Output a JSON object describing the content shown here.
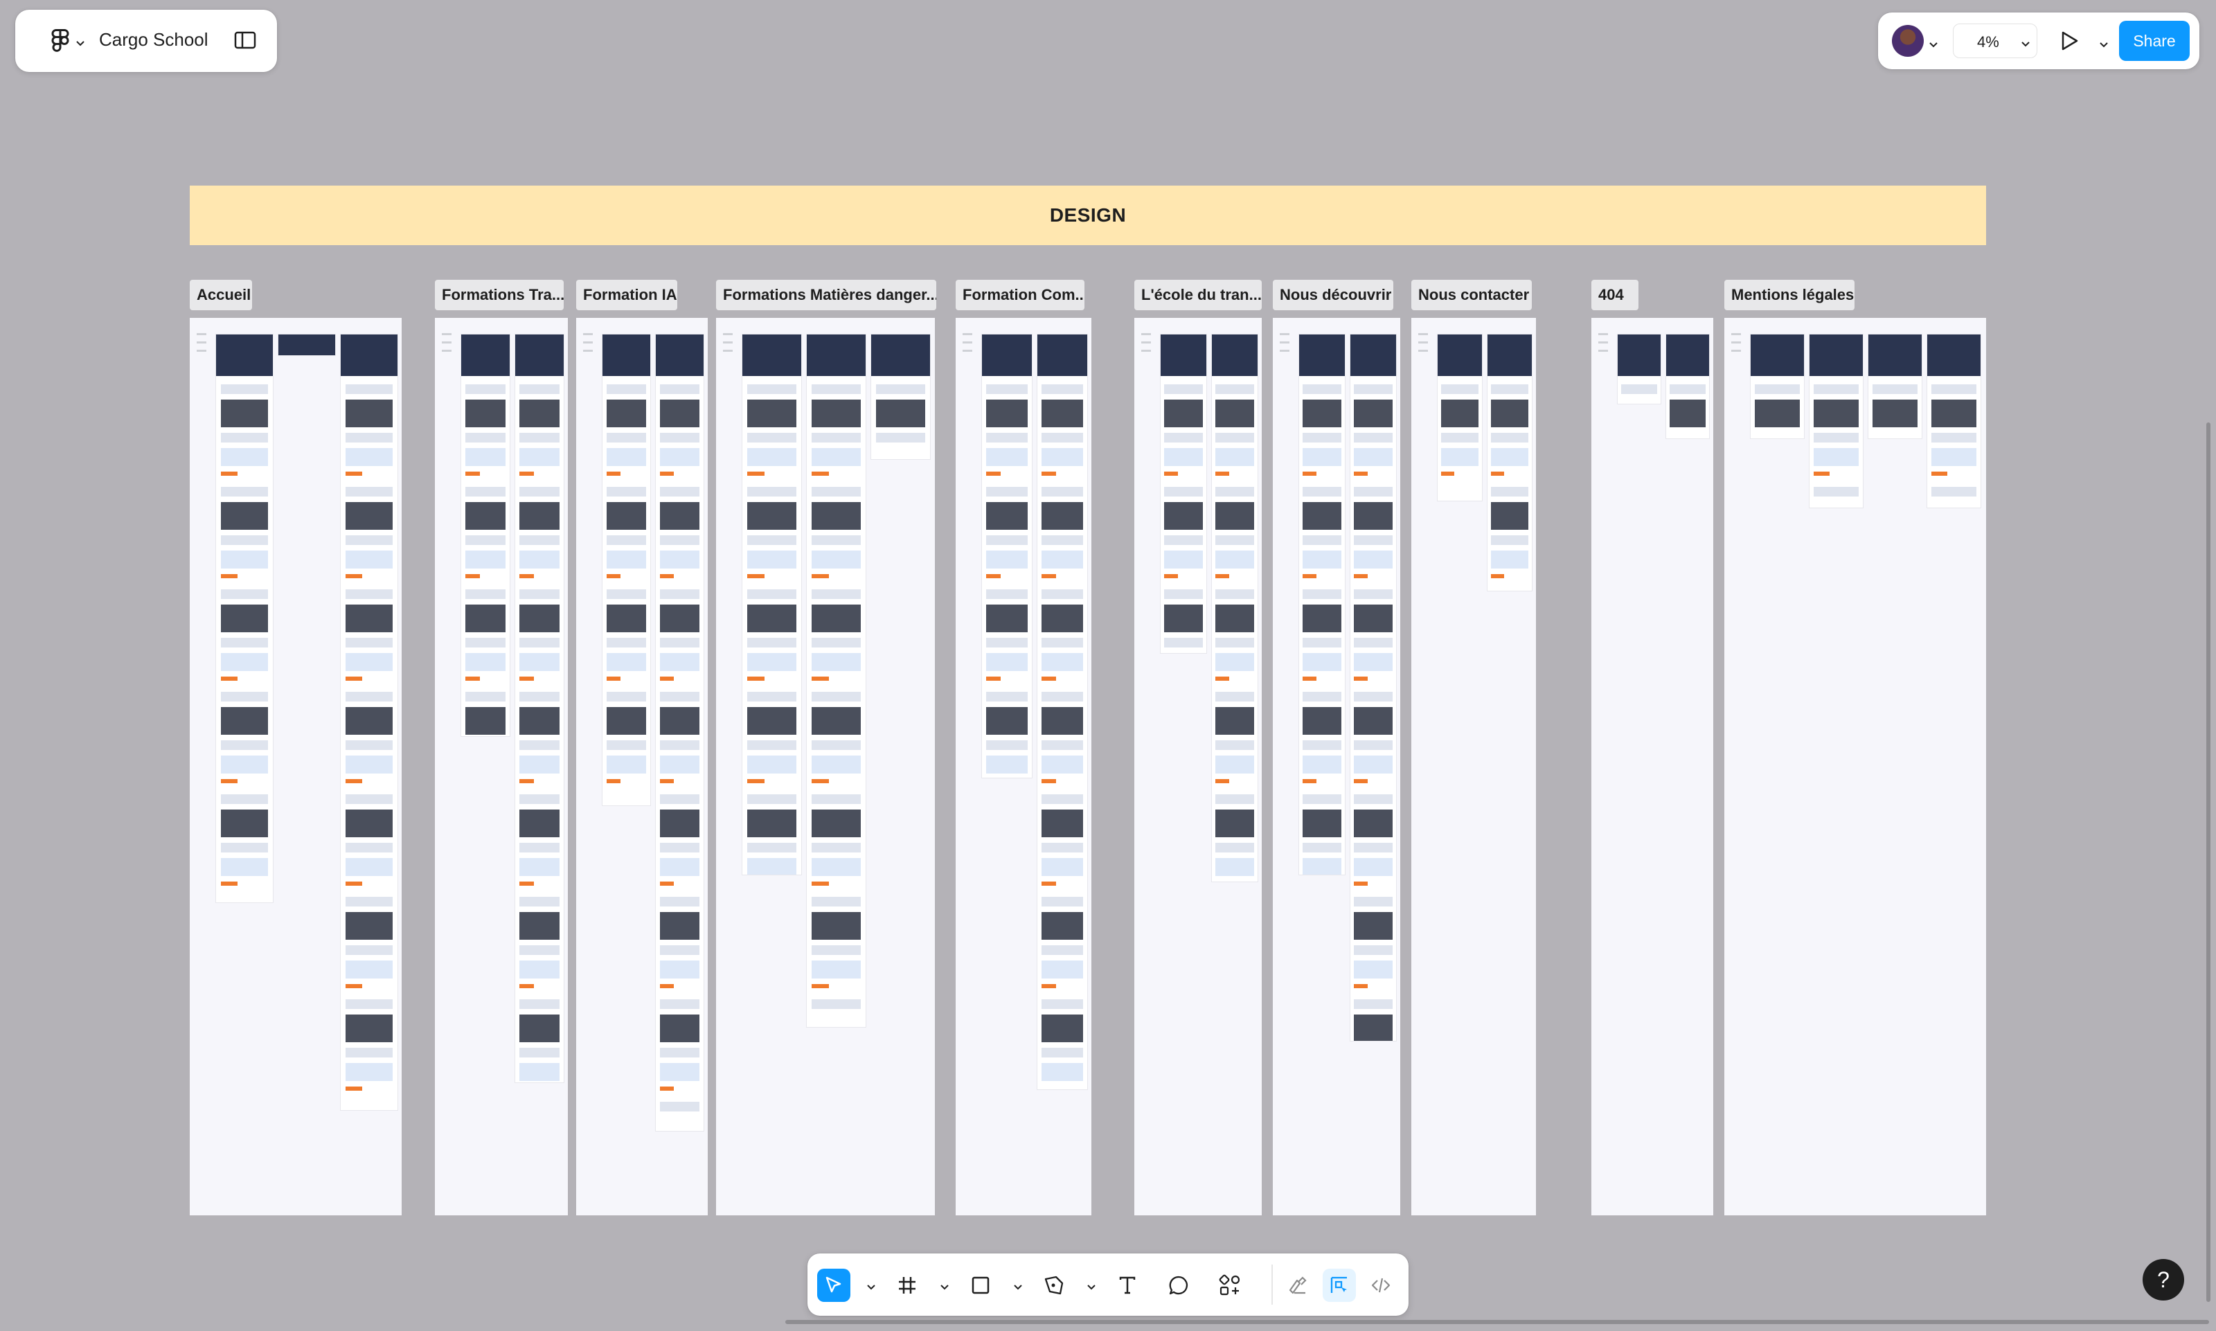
{
  "file": {
    "title": "Cargo School"
  },
  "topbar": {
    "zoom": "4%",
    "share_label": "Share"
  },
  "canvas": {
    "banner": "DESIGN",
    "sections": [
      {
        "label": "Accueil",
        "pages": 3
      },
      {
        "label": "Formations Tra...",
        "pages": 2
      },
      {
        "label": "Formation IA",
        "pages": 2
      },
      {
        "label": "Formations Matières danger...",
        "pages": 3
      },
      {
        "label": "Formation Com...",
        "pages": 2
      },
      {
        "label": "L'école du tran...",
        "pages": 2
      },
      {
        "label": "Nous découvrir",
        "pages": 2
      },
      {
        "label": "Nous contacter",
        "pages": 2
      },
      {
        "label": "404",
        "pages": 2
      },
      {
        "label": "Mentions légales",
        "pages": 4
      }
    ]
  },
  "toolbar": {
    "tools": [
      "move-tool",
      "frame-tool",
      "shape-tool",
      "pen-tool",
      "text-tool",
      "comment-tool",
      "actions-tool",
      "draw-mode",
      "design-mode",
      "dev-mode"
    ]
  },
  "help": {
    "label": "?"
  },
  "colors": {
    "accent": "#0d99ff",
    "banner": "#ffe7b0",
    "canvas": "#b4b2b7"
  }
}
